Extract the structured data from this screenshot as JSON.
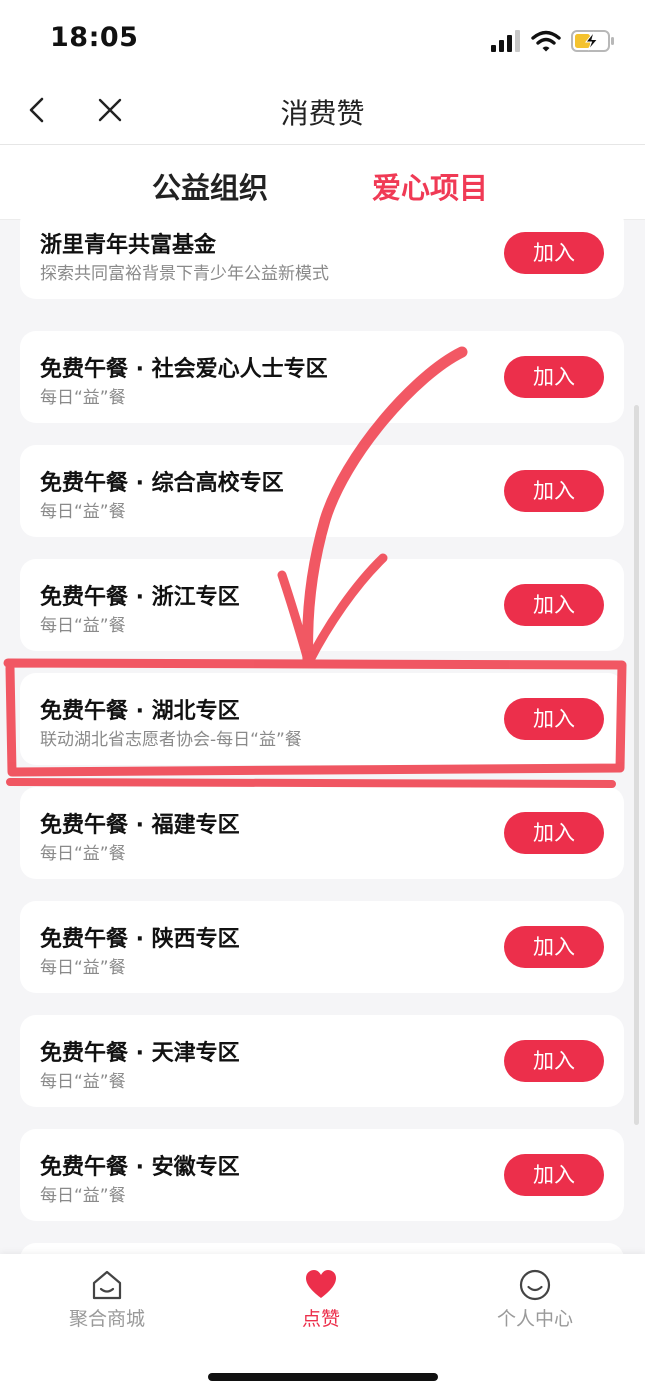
{
  "status": {
    "time": "18:05"
  },
  "nav": {
    "title": "消费赞",
    "back_icon": "chevron-left-icon",
    "close_icon": "close-icon"
  },
  "tabs": [
    {
      "label": "公益组织",
      "active": false
    },
    {
      "label": "爱心项目",
      "active": true
    }
  ],
  "items": [
    {
      "title": "浙里青年共富基金",
      "subtitle": "探索共同富裕背景下青少年公益新模式",
      "button": "加入"
    },
    {
      "title": "免费午餐 · 社会爱心人士专区",
      "subtitle": "每日“益”餐",
      "button": "加入"
    },
    {
      "title": "免费午餐 · 综合高校专区",
      "subtitle": "每日“益”餐",
      "button": "加入"
    },
    {
      "title": "免费午餐 · 浙江专区",
      "subtitle": "每日“益”餐",
      "button": "加入"
    },
    {
      "title": "免费午餐 · 湖北专区",
      "subtitle": "联动湖北省志愿者协会-每日“益”餐",
      "button": "加入",
      "highlighted": true
    },
    {
      "title": "免费午餐 · 福建专区",
      "subtitle": "每日“益”餐",
      "button": "加入"
    },
    {
      "title": "免费午餐 · 陕西专区",
      "subtitle": "每日“益”餐",
      "button": "加入"
    },
    {
      "title": "免费午餐 · 天津专区",
      "subtitle": "每日“益”餐",
      "button": "加入"
    },
    {
      "title": "免费午餐 · 安徽专区",
      "subtitle": "每日“益”餐",
      "button": "加入"
    }
  ],
  "bottom_nav": [
    {
      "label": "聚合商城",
      "icon": "home-icon",
      "active": false
    },
    {
      "label": "点赞",
      "icon": "heart-icon",
      "active": true
    },
    {
      "label": "个人中心",
      "icon": "smiley-icon",
      "active": false
    }
  ],
  "colors": {
    "accent": "#ec2f4b",
    "annotation": "#f0414e"
  }
}
